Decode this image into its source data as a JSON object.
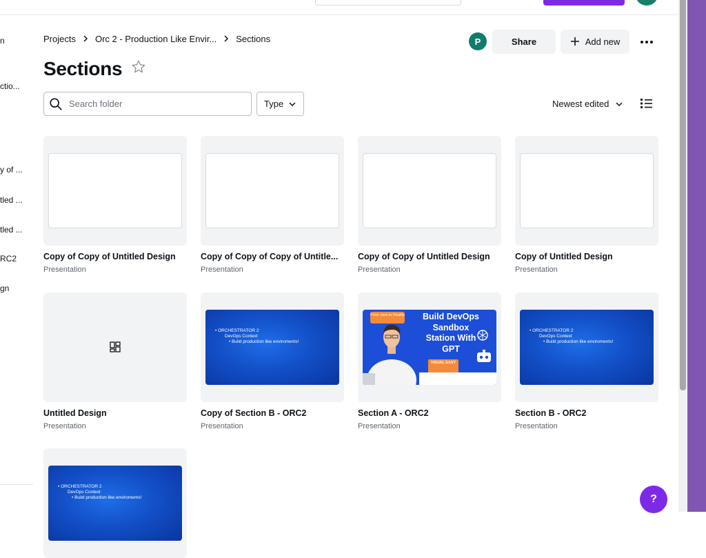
{
  "sidebar": {
    "items": [
      "n",
      "ctio...",
      "y of ...",
      "tled ...",
      "tled ...",
      "RC2",
      "gn"
    ]
  },
  "breadcrumb": {
    "items": [
      "Projects",
      "Orc 2 - Production Like Envir...",
      "Sections"
    ],
    "separator": "›"
  },
  "header": {
    "title": "Sections",
    "avatar_initial": "P",
    "share_label": "Share",
    "add_new_label": "Add new"
  },
  "filters": {
    "search_placeholder": "Search folder",
    "type_label": "Type",
    "sort_label": "Newest edited"
  },
  "cards": [
    {
      "title": "Copy of Copy of Untitled Design",
      "subtitle": "Presentation",
      "thumb": "blank"
    },
    {
      "title": "Copy of Copy of Copy of Untitle...",
      "subtitle": "Presentation",
      "thumb": "blank"
    },
    {
      "title": "Copy of Copy of Untitled Design",
      "subtitle": "Presentation",
      "thumb": "blank"
    },
    {
      "title": "Copy of Untitled Design",
      "subtitle": "Presentation",
      "thumb": "blank"
    },
    {
      "title": "Untitled Design",
      "subtitle": "Presentation",
      "thumb": "grid-icon"
    },
    {
      "title": "Copy of Section B - ORC2",
      "subtitle": "Presentation",
      "thumb": "orchestrator"
    },
    {
      "title": "Section A - ORC2",
      "subtitle": "Presentation",
      "thumb": "build-devops"
    },
    {
      "title": "Section B - ORC2",
      "subtitle": "Presentation",
      "thumb": "orchestrator"
    },
    {
      "title": "",
      "subtitle": "",
      "thumb": "orchestrator"
    }
  ],
  "orchestrator_thumb": {
    "line1": "• ORCHESTRATOR 2",
    "line2": "DevOps Context",
    "line3": "• Build production like enviroments!"
  },
  "build_thumb": {
    "tag": "From Idea to Reality",
    "title": "Build DevOps Sandbox Station With GPT",
    "badge": "VISUAL EASY"
  },
  "help_label": "?",
  "colors": {
    "accent": "#7d2ae8",
    "avatar": "#0e7d6b",
    "card_bg": "#f2f3f5",
    "thumb_blue": "#1350c8"
  }
}
